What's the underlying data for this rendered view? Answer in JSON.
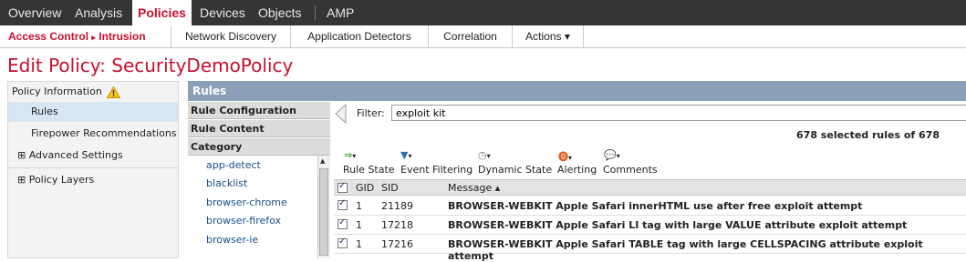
{
  "topnav": {
    "items": [
      "Overview",
      "Analysis",
      "Policies",
      "Devices",
      "Objects",
      "AMP"
    ]
  },
  "subnav": {
    "access_control": "Access Control",
    "arrow": "▸",
    "intrusion": "Intrusion",
    "items": [
      "Network Discovery",
      "Application Detectors",
      "Correlation",
      "Actions ▾"
    ]
  },
  "page_title": "Edit Policy: SecurityDemoPolicy",
  "leftnav": {
    "policy_information": "Policy Information",
    "rules": "Rules",
    "firepower": "Firepower Recommendations",
    "advanced": "⊞ Advanced Settings",
    "layers": "⊞ Policy Layers"
  },
  "rules_header": "Rules",
  "side_sections": [
    "Rule Configuration",
    "Rule Content",
    "Category"
  ],
  "categories": [
    "app-detect",
    "blacklist",
    "browser-chrome",
    "browser-firefox",
    "browser-ie"
  ],
  "filter": {
    "label": "Filter:",
    "value": "exploit kit"
  },
  "selected_count": "678 selected rules of 678",
  "toolbar": [
    "Rule State",
    "Event Filtering",
    "Dynamic State",
    "Alerting",
    "Comments"
  ],
  "table": {
    "headers": {
      "gid": "GID",
      "sid": "SID",
      "message": "Message ▴"
    },
    "rows": [
      {
        "gid": "1",
        "sid": "21189",
        "message": "BROWSER-WEBKIT Apple Safari innerHTML use after free exploit attempt"
      },
      {
        "gid": "1",
        "sid": "17218",
        "message": "BROWSER-WEBKIT Apple Safari LI tag with large VALUE attribute exploit attempt"
      },
      {
        "gid": "1",
        "sid": "17216",
        "message": "BROWSER-WEBKIT Apple Safari TABLE tag with large CELLSPACING attribute exploit attempt"
      }
    ]
  },
  "colors": {
    "brand_red": "#c8102e",
    "nav_dark": "#353535",
    "rules_bar": "#8a9fb8"
  }
}
